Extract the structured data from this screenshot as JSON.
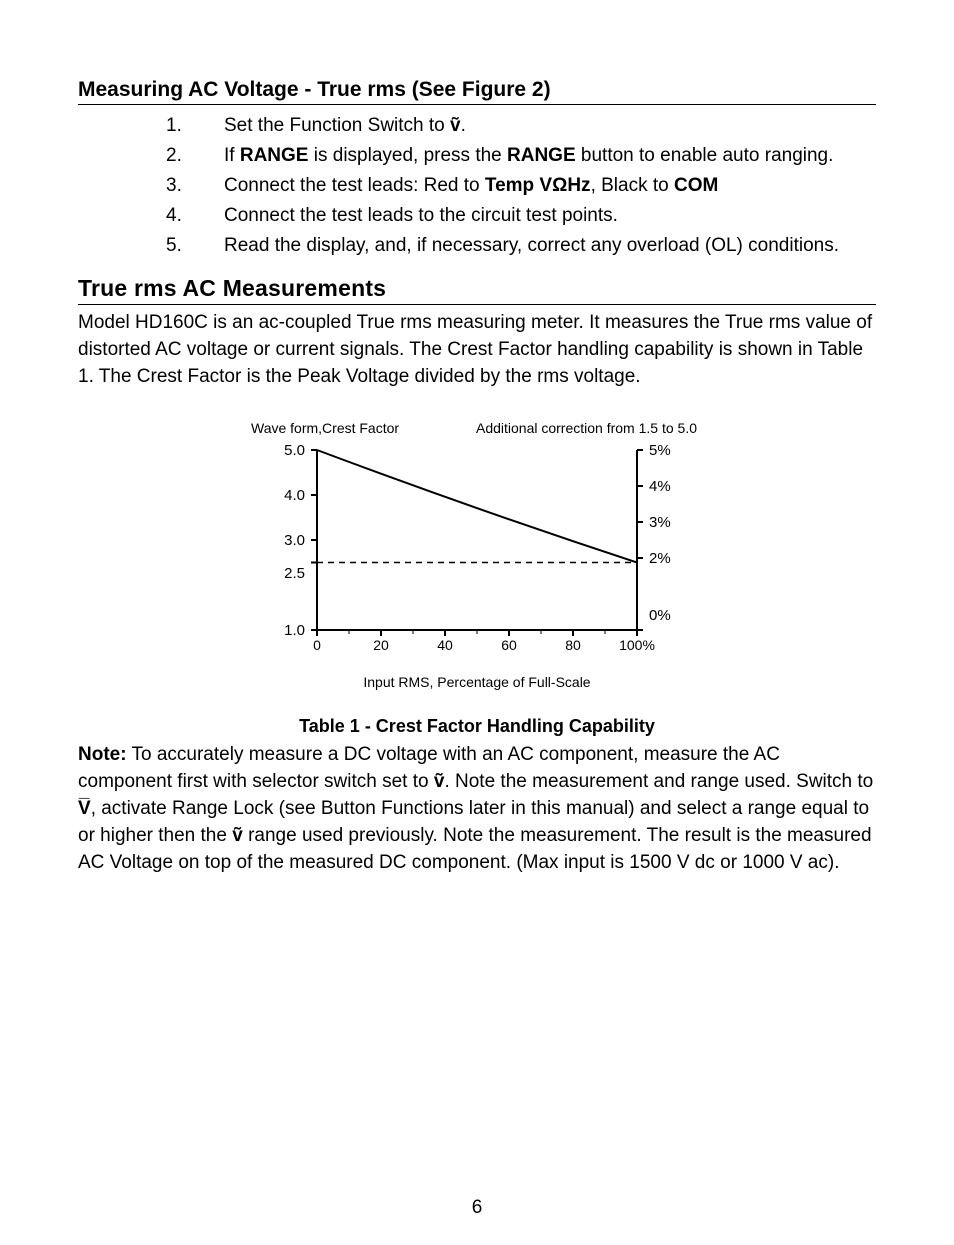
{
  "section1": {
    "heading": "Measuring AC Voltage - True rms (See Figure 2)",
    "steps": [
      {
        "n": "1.",
        "prefix": "Set the Function Switch to ",
        "glyph": "ṽ",
        "suffix": "."
      },
      {
        "n": "2.",
        "parts": [
          "If ",
          "RANGE",
          " is displayed, press the ",
          "RANGE",
          " button to enable auto ranging."
        ]
      },
      {
        "n": "3.",
        "parts": [
          "Connect the test leads: Red to ",
          "Temp VΩHz",
          ", Black to ",
          "COM"
        ]
      },
      {
        "n": "4.",
        "plain": "Connect the test leads to the circuit test points."
      },
      {
        "n": "5.",
        "plain": "Read the display, and, if necessary, correct any overload (OL) conditions."
      }
    ]
  },
  "section2": {
    "heading": "True rms AC Measurements",
    "para": "Model HD160C is an ac-coupled True rms measuring meter. It measures the True rms value of distorted AC voltage or current signals. The Crest Factor handling capability is shown in Table 1. The Crest Factor is the Peak Voltage divided by the rms voltage."
  },
  "chart_data": {
    "type": "line",
    "title_left": "Wave form,Crest Factor",
    "title_right": "Additional correction from 1.5 to 5.0",
    "xlabel": "Input RMS, Percentage of Full-Scale",
    "x_ticks": [
      "0",
      "20",
      "40",
      "60",
      "80",
      "100%"
    ],
    "y_left_ticks": [
      "5.0",
      "4.0",
      "3.0",
      "2.5",
      "1.0"
    ],
    "y_right_ticks": [
      "5%",
      "4%",
      "3%",
      "2%",
      "0%"
    ],
    "series": [
      {
        "name": "crest_curve",
        "style": "solid",
        "points": [
          {
            "x": 0,
            "y": 5.0
          },
          {
            "x": 100,
            "y": 2.5
          }
        ]
      },
      {
        "name": "dashed_ref",
        "style": "dashed",
        "points": [
          {
            "x": 0,
            "y": 2.5
          },
          {
            "x": 100,
            "y": 2.5
          }
        ]
      }
    ],
    "axes": {
      "xlim": [
        0,
        100
      ],
      "ylim_left": [
        1.0,
        5.0
      ],
      "ylim_right": [
        0,
        5
      ]
    }
  },
  "table_caption": "Table 1 - Crest Factor Handling Capability",
  "note": {
    "label": "Note:",
    "t1": " To accurately measure a DC voltage with an AC component, measure the AC component first with selector switch set to ",
    "g1": "ṽ",
    "t2": ". Note the measurement and range used. Switch to ",
    "g2": "V̅",
    "t3": ", activate Range Lock (see Button Functions later in this manual) and select a range equal to or higher then the ",
    "g3": "ṽ",
    "t4": " range used previously. Note the measurement. The result is the measured AC Voltage on top of the measured DC component. (Max input is 1500 V dc or 1000 V ac)."
  },
  "page_number": "6"
}
